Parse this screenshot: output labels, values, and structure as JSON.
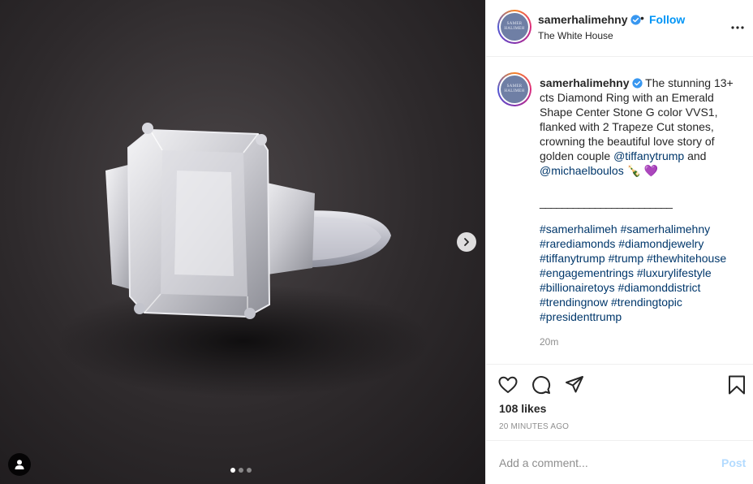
{
  "post": {
    "username": "samerhalimehny",
    "separator": "•",
    "follow_label": "Follow",
    "location": "The White House",
    "avatar_text": "SAMER HALIMEH",
    "caption": {
      "username": "samerhalimehny",
      "text": "The stunning 13+ cts Diamond Ring with an Emerald Shape Center Stone G color VVS1, flanked with 2 Trapeze Cut stones, crowning the beautiful love story of golden couple",
      "mention1": "@tiffanytrump",
      "and_text": "and",
      "mention2": "@michaelboulos",
      "emoji": "🍾 💜"
    },
    "divider": "________________________",
    "hashtags": [
      "#samerhalimeh",
      "#samerhalimehny",
      "#rarediamonds",
      "#diamondjewelry",
      "#tiffanytrump",
      "#trump",
      "#thewhitehouse",
      "#engagementrings",
      "#luxurylifestyle",
      "#billionairetoys",
      "#diamonddistrict",
      "#trendingnow",
      "#trendingtopic",
      "#presidenttrump"
    ],
    "caption_time": "20m",
    "likes": "108 likes",
    "time_ago": "20 MINUTES AGO",
    "comment_placeholder": "Add a comment...",
    "post_label": "Post"
  },
  "carousel": {
    "total": 3,
    "active": 0
  },
  "colors": {
    "link": "#00376b",
    "follow": "#0095f6",
    "post_disabled": "#b3dbff",
    "verified": "#3897f0"
  },
  "icons": [
    "heart-icon",
    "comment-icon",
    "share-icon",
    "bookmark-icon",
    "more-icon",
    "chevron-right-icon",
    "user-tag-icon",
    "verified-icon"
  ]
}
